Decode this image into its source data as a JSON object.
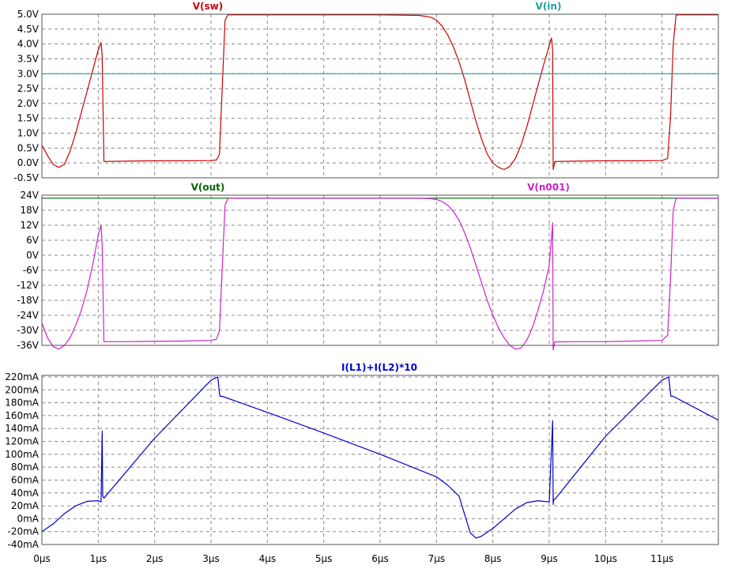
{
  "chart_data": [
    {
      "type": "line",
      "title": "",
      "xlabel": "",
      "ylabel": "",
      "xlim": [
        0,
        12
      ],
      "ylim": [
        -0.5,
        5.0
      ],
      "grid": true,
      "x_ticks": [],
      "y_ticks": [
        "5.0V",
        "4.5V",
        "4.0V",
        "3.5V",
        "3.0V",
        "2.5V",
        "2.0V",
        "1.5V",
        "1.0V",
        "0.5V",
        "0.0V",
        "-0.5V"
      ],
      "series": [
        {
          "name": "V(sw)",
          "color": "#cc0000",
          "x": [
            0,
            0.1,
            0.2,
            0.3,
            0.4,
            0.5,
            0.6,
            0.7,
            0.8,
            0.9,
            1.0,
            1.05,
            1.07,
            1.1,
            1.5,
            2.0,
            2.5,
            3.0,
            3.1,
            3.15,
            3.25,
            3.3,
            3.5,
            4,
            5,
            6,
            6.7,
            6.9,
            7.0,
            7.1,
            7.2,
            7.3,
            7.4,
            7.5,
            7.6,
            7.7,
            7.8,
            7.9,
            8.0,
            8.1,
            8.2,
            8.3,
            8.4,
            8.5,
            8.6,
            8.7,
            8.8,
            8.9,
            9.0,
            9.04,
            9.06,
            9.07,
            9.1,
            9.5,
            10,
            10.5,
            11.0,
            11.1,
            11.15,
            11.2,
            11.25,
            11.3,
            12
          ],
          "y": [
            0.6,
            0.25,
            -0.05,
            -0.15,
            -0.05,
            0.4,
            1.0,
            1.7,
            2.4,
            3.1,
            3.8,
            4.05,
            3.6,
            0.05,
            0.06,
            0.07,
            0.07,
            0.08,
            0.1,
            0.3,
            4.8,
            4.98,
            4.98,
            4.98,
            4.98,
            4.98,
            4.96,
            4.9,
            4.8,
            4.6,
            4.3,
            3.9,
            3.4,
            2.8,
            2.1,
            1.4,
            0.8,
            0.3,
            0.0,
            -0.15,
            -0.22,
            -0.12,
            0.15,
            0.6,
            1.2,
            1.9,
            2.6,
            3.3,
            3.95,
            4.2,
            3.8,
            -0.22,
            0.05,
            0.06,
            0.07,
            0.07,
            0.08,
            0.15,
            1.5,
            4.0,
            4.97,
            4.98,
            4.98
          ]
        },
        {
          "name": "V(in)",
          "color": "#21a0a0",
          "x": [
            0,
            12
          ],
          "y": [
            3.0,
            3.0
          ]
        }
      ]
    },
    {
      "type": "line",
      "title": "",
      "xlabel": "",
      "ylabel": "",
      "xlim": [
        0,
        12
      ],
      "ylim": [
        -39,
        24
      ],
      "grid": true,
      "x_ticks": [],
      "y_ticks": [
        "24V",
        "18V",
        "12V",
        "6V",
        "0V",
        "-6V",
        "-12V",
        "-18V",
        "-24V",
        "-30V",
        "-36V"
      ],
      "series": [
        {
          "name": "V(out)",
          "color": "#006400",
          "x": [
            0,
            12
          ],
          "y": [
            22.8,
            22.8
          ]
        },
        {
          "name": "V(n001)",
          "color": "#cc22cc",
          "x": [
            0,
            0.1,
            0.2,
            0.3,
            0.4,
            0.5,
            0.6,
            0.7,
            0.8,
            0.9,
            1.0,
            1.05,
            1.07,
            1.1,
            1.5,
            2.0,
            2.5,
            3.0,
            3.1,
            3.15,
            3.25,
            3.3,
            3.5,
            4,
            5,
            6,
            6.7,
            6.9,
            7.0,
            7.1,
            7.2,
            7.3,
            7.4,
            7.5,
            7.6,
            7.7,
            7.8,
            7.9,
            8.0,
            8.1,
            8.2,
            8.3,
            8.4,
            8.5,
            8.6,
            8.7,
            8.8,
            8.9,
            9.0,
            9.04,
            9.06,
            9.07,
            9.1,
            9.5,
            10,
            10.5,
            11.0,
            11.1,
            11.15,
            11.2,
            11.25,
            11.3,
            12
          ],
          "y": [
            -27,
            -33,
            -36.5,
            -37.5,
            -36,
            -33,
            -28,
            -22,
            -14,
            -4,
            8,
            12,
            4,
            -34.5,
            -34.5,
            -34.4,
            -34.3,
            -34.0,
            -33.5,
            -30,
            20,
            22.8,
            22.8,
            22.8,
            22.8,
            22.8,
            22.8,
            22.6,
            22.3,
            21.5,
            20,
            17.5,
            14,
            9,
            3,
            -4,
            -11,
            -18,
            -24,
            -29,
            -33,
            -36,
            -37.5,
            -37,
            -34,
            -29,
            -22,
            -14,
            -4,
            7,
            13,
            -37.8,
            -34.6,
            -34.5,
            -34.5,
            -34.3,
            -34.0,
            -32,
            -10,
            18,
            22.8,
            22.8,
            22.8
          ]
        }
      ]
    },
    {
      "type": "line",
      "title": "",
      "xlabel": "",
      "ylabel": "",
      "xlim": [
        0,
        12
      ],
      "ylim": [
        -40,
        220
      ],
      "grid": true,
      "x_ticks": [
        "0µs",
        "1µs",
        "2µs",
        "3µs",
        "4µs",
        "5µs",
        "6µs",
        "7µs",
        "8µs",
        "9µs",
        "10µs",
        "11µs"
      ],
      "y_ticks": [
        "220mA",
        "200mA",
        "180mA",
        "160mA",
        "140mA",
        "120mA",
        "100mA",
        "80mA",
        "60mA",
        "40mA",
        "20mA",
        "0mA",
        "-20mA",
        "-40mA"
      ],
      "series": [
        {
          "name": "I(L1)+I(L2)*10",
          "color": "#0000cc",
          "x": [
            0,
            0.2,
            0.4,
            0.6,
            0.8,
            1.0,
            1.05,
            1.07,
            1.08,
            1.1,
            2.0,
            3.0,
            3.12,
            3.15,
            3.16,
            3.2,
            4,
            5,
            6,
            7,
            7.2,
            7.4,
            7.6,
            7.7,
            7.8,
            8.0,
            8.2,
            8.4,
            8.6,
            8.8,
            9.0,
            9.06,
            9.07,
            9.08,
            9.1,
            10,
            11.0,
            11.12,
            11.15,
            11.16,
            11.2,
            12
          ],
          "y": [
            -20,
            -8,
            8,
            20,
            27,
            28,
            26,
            136,
            35,
            32,
            125,
            215,
            220,
            195,
            190,
            190,
            165,
            133,
            100,
            65,
            52,
            35,
            -22,
            -30,
            -27,
            -15,
            0,
            15,
            25,
            28,
            26,
            152,
            22,
            30,
            30,
            128,
            215,
            220,
            195,
            190,
            190,
            153
          ]
        }
      ]
    }
  ]
}
